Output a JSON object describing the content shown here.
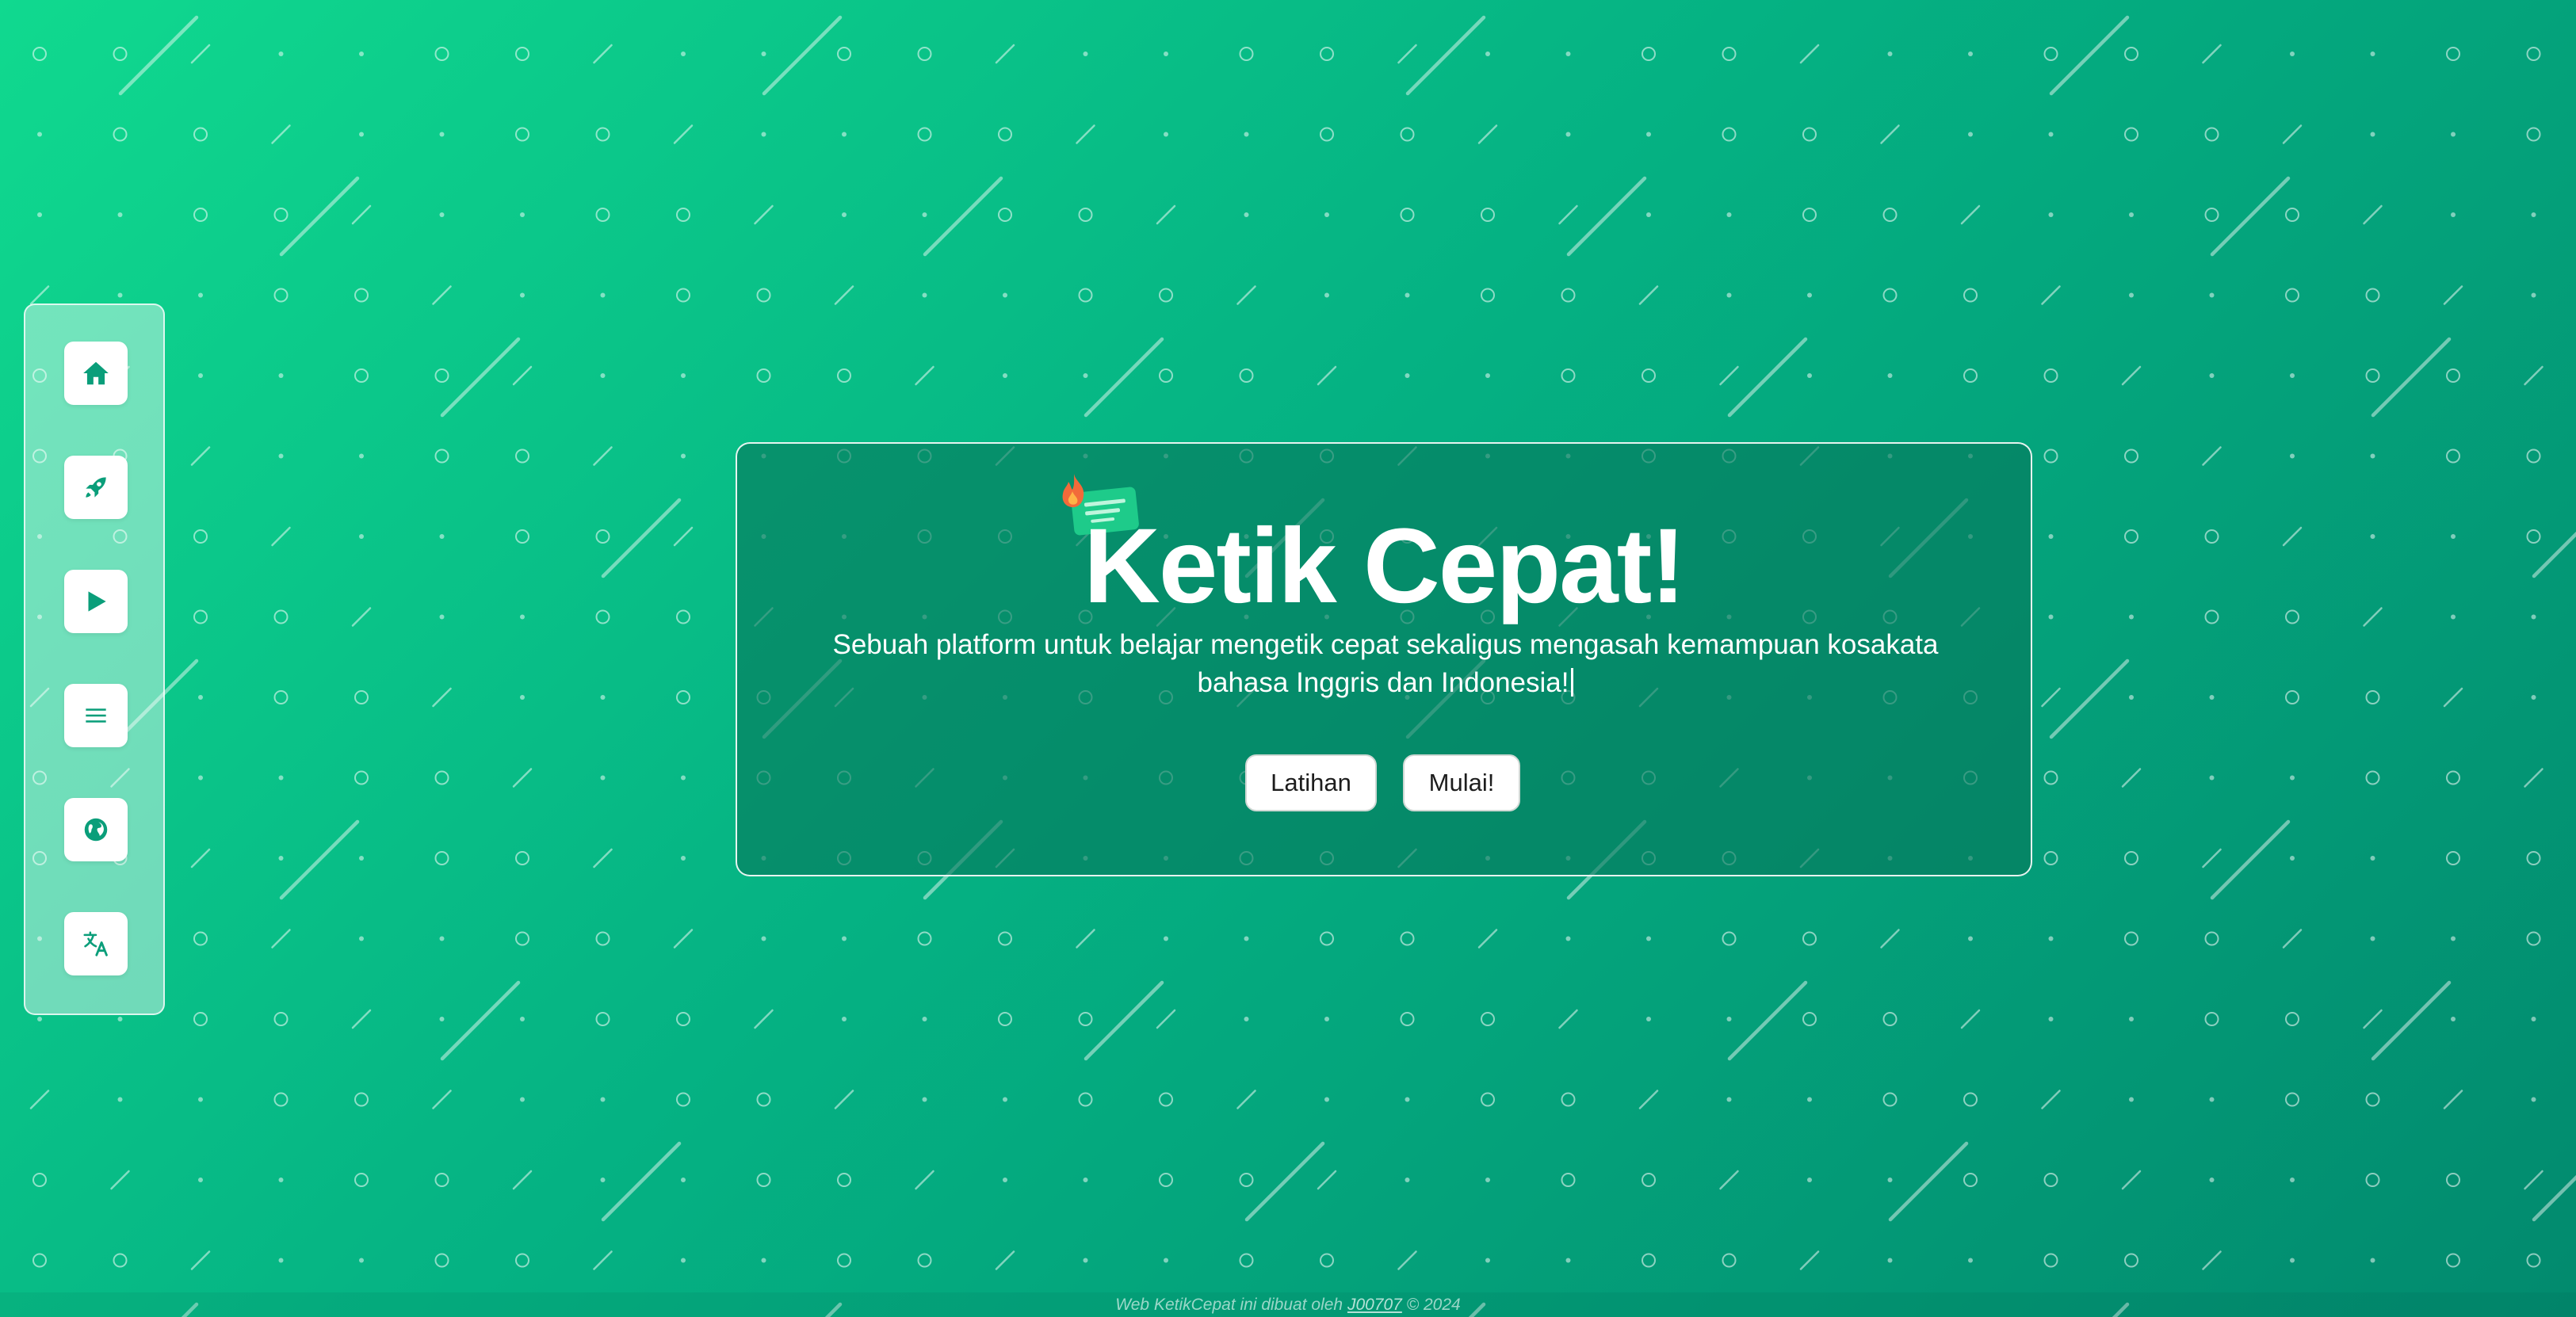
{
  "sidebar": {
    "items": [
      {
        "icon": "home-icon"
      },
      {
        "icon": "rocket-icon"
      },
      {
        "icon": "play-icon"
      },
      {
        "icon": "menu-icon"
      },
      {
        "icon": "globe-icon"
      },
      {
        "icon": "translate-icon"
      }
    ]
  },
  "hero": {
    "title": "Ketik Cepat!",
    "subtitle": "Sebuah platform untuk belajar mengetik cepat sekaligus mengasah kemampuan kosakata bahasa Inggris dan Indonesia!",
    "buttons": {
      "practice_label": "Latihan",
      "start_label": "Mulai!"
    }
  },
  "footer": {
    "prefix": "Web KetikCepat ini dibuat oleh ",
    "author": "J00707",
    "suffix": " © 2024"
  },
  "colors": {
    "gradient_start": "#10d98f",
    "gradient_end": "#028a6e",
    "card_bg": "#06785c",
    "icon_accent": "#0a9e7a",
    "flame": "#f26a3a",
    "keyboard": "#1ecb8a"
  }
}
